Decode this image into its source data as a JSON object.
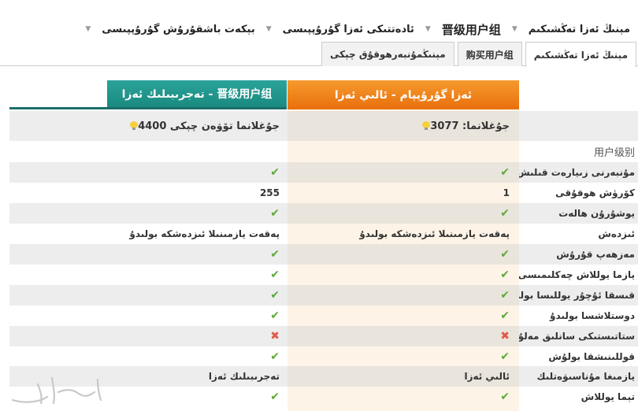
{
  "breadcrumb": [
    {
      "label": "مېنىڭ ئەزا تەڭشىكىم",
      "big": false
    },
    {
      "label": "晋级用户组",
      "big": true
    },
    {
      "label": "ئادەتتىكى ئەزا گۇرۇپپىسى",
      "big": false
    },
    {
      "label": "بېكەت باشقۇرۇش گۇرۇپپىسى",
      "big": false
    }
  ],
  "tabs": [
    {
      "label": "مېنىڭ ئەزا تەڭشىكىم",
      "active": true
    },
    {
      "label": "购买用户组",
      "active": false
    },
    {
      "label": "مېنىڭمۇنبەرھوقۇق چېكى",
      "active": false
    }
  ],
  "plans": {
    "current": {
      "title": "ئەزا گۇرۇپپام - ئالىي ئەزا",
      "score": "جۇغلانما: 3077",
      "footer": "ئالىي ئەزا",
      "color": "#ee7f1a"
    },
    "upgrade": {
      "title": "晋级用户组 - تەجرىبىلىك ئەزا",
      "score": "جۇغلانما تۆۋەن چېكى 4400",
      "footer": "تەجرىبىلىك ئەزا",
      "color": "#1f8f86"
    }
  },
  "section_label": "用户级别",
  "rows": [
    {
      "label": "مۇنبەرنى زىيارەت قىلىش",
      "current": "check",
      "upgrade": "check"
    },
    {
      "label": "كۆرۈش ھوقۇقى",
      "current": "1",
      "upgrade": "255"
    },
    {
      "label": "يوشۇرۇن ھالەت",
      "current": "check",
      "upgrade": "check"
    },
    {
      "label": "ئىزدەش",
      "current": "پەقەت يازمىنىلا ئىزدەشكە بولىدۇ",
      "upgrade": "پەقەت يازمىنىلا ئىزدەشكە بولىدۇ"
    },
    {
      "label": "مەزھەپ قۇرۇش",
      "current": "check",
      "upgrade": "check"
    },
    {
      "label": "يازما يوللاش چەكلىمىسى يوق",
      "current": "check",
      "upgrade": "check"
    },
    {
      "label": "قىسقا ئۇچۇر يوللىسا بولىدۇ",
      "current": "check",
      "upgrade": "check"
    },
    {
      "label": "دوستلاشسا بولىدۇ",
      "current": "check",
      "upgrade": "check"
    },
    {
      "label": "ستاتىستىكى سانلىق مەلۇماتى",
      "current": "cross",
      "upgrade": "cross"
    },
    {
      "label": "قوللىنىشقا بولۇش",
      "current": "check",
      "upgrade": "check"
    }
  ],
  "footer_label": "يازمىغا مۇناسىۋەتلىك",
  "last_row": {
    "label": "تېما يوللاش",
    "current": "check",
    "upgrade": "check"
  },
  "icons": {
    "check": "check-icon",
    "cross": "cross-icon",
    "bulb": "lightbulb-icon"
  }
}
